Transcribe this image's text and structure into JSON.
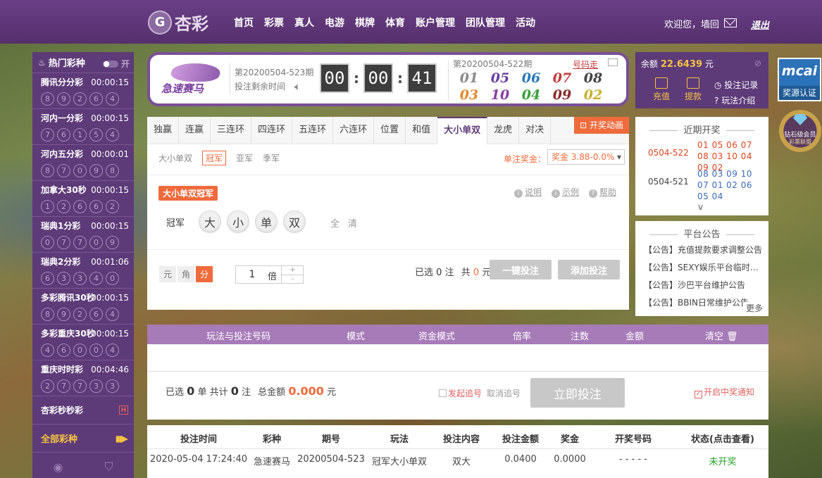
{
  "nav": {
    "logo_char": "G",
    "logo_text": "杏彩",
    "items": [
      "首页",
      "彩票",
      "真人",
      "电游",
      "棋牌",
      "体育",
      "账户管理",
      "团队管理",
      "活动"
    ],
    "welcome": "欢迎您，墙回",
    "logout": "退出"
  },
  "sidebar": {
    "title": "热门彩种",
    "toggle": "开",
    "games": [
      {
        "name": "腾讯分分彩",
        "time": "00:00:15",
        "balls": [
          "8",
          "9",
          "2",
          "6",
          "4"
        ]
      },
      {
        "name": "河内一分彩",
        "time": "00:00:15",
        "balls": [
          "7",
          "6",
          "1",
          "5",
          "4"
        ]
      },
      {
        "name": "河内五分彩",
        "time": "00:00:01",
        "balls": [
          "8",
          "7",
          "0",
          "9",
          "8"
        ]
      },
      {
        "name": "加拿大30秒",
        "time": "00:00:15",
        "balls": [
          "1",
          "2",
          "6",
          "6",
          "2"
        ]
      },
      {
        "name": "瑞典1分彩",
        "time": "00:00:15",
        "balls": [
          "0",
          "7",
          "7",
          "0",
          "9"
        ]
      },
      {
        "name": "瑞典2分彩",
        "time": "00:01:06",
        "balls": [
          "6",
          "3",
          "3",
          "4",
          "0"
        ]
      },
      {
        "name": "多彩腾讯30秒",
        "time": "00:00:15",
        "balls": [
          "8",
          "9",
          "2",
          "6",
          "4"
        ]
      },
      {
        "name": "多彩重庆30秒",
        "time": "00:00:15",
        "balls": [
          "4",
          "6",
          "0",
          "0",
          "4"
        ]
      },
      {
        "name": "重庆时时彩",
        "time": "00:04:46",
        "balls": [
          "2",
          "7",
          "7",
          "3",
          "3"
        ]
      }
    ],
    "special": "杏彩秒秒彩",
    "all": "全部彩种"
  },
  "lottery": {
    "logo_text": "急速赛马",
    "period": "第20200504-523期",
    "remain_label": "投注剩余时间",
    "timer": [
      "00",
      "00",
      "41"
    ],
    "last_period": "第20200504-522期",
    "trend": "号码走",
    "results": [
      {
        "num": "01",
        "color": "#8a8a8a"
      },
      {
        "num": "05",
        "color": "#6a3fa0"
      },
      {
        "num": "06",
        "color": "#2a7ab8"
      },
      {
        "num": "07",
        "color": "#c43a3a"
      },
      {
        "num": "08",
        "color": "#444444"
      },
      {
        "num": "03",
        "color": "#e08a2a"
      },
      {
        "num": "10",
        "color": "#8a3fa0"
      },
      {
        "num": "04",
        "color": "#3aa03a"
      },
      {
        "num": "09",
        "color": "#8a2a2a"
      },
      {
        "num": "02",
        "color": "#c8b030"
      }
    ]
  },
  "balance": {
    "label": "余额",
    "amount": "22.6439",
    "unit": "元",
    "recharge": "充值",
    "withdraw": "提款",
    "record": "投注记录",
    "rules": "玩法介绍"
  },
  "recent": {
    "title": "近期开奖",
    "rows": [
      {
        "id": "0504-522",
        "nums": "01 05 06 07 08 03 10 04 09 02",
        "color": "#d9441c"
      },
      {
        "id": "0504-521",
        "nums": "08 03 09 10 07 01 02 06 05 04",
        "color": "#3a6ab8"
      }
    ],
    "more_icon": "v"
  },
  "notice": {
    "title": "平台公告",
    "items": [
      "【公告】充值提款要求调整公告",
      "【公告】SEXY娱乐平台临时维...",
      "【公告】沙巴平台维护公告",
      "【公告】BBIN日常维护公告"
    ],
    "more": "更多"
  },
  "badges": {
    "mcai": "mcai",
    "mcai_sub": "奖源认证",
    "diamond_1": "钻石级会员",
    "diamond_2": "彩票联盟"
  },
  "play": {
    "tabs": [
      "独赢",
      "连赢",
      "三连环",
      "四连环",
      "五连环",
      "六连环",
      "位置",
      "和值",
      "大小单双",
      "龙虎",
      "对决"
    ],
    "active_tab": 8,
    "open_anim": "开奖动画",
    "subtabs": [
      "大小单双",
      "冠军",
      "亚军",
      "季军"
    ],
    "active_subtab": 1,
    "bonus_label": "单注奖金：",
    "bonus_value": "奖金 3.88-0.0%",
    "mode_title": "大小单双冠军",
    "help": [
      "说明",
      "示例",
      "帮助"
    ],
    "position": "冠军",
    "picks": [
      "大",
      "小",
      "单",
      "双"
    ],
    "quick": [
      "全",
      "清"
    ],
    "units": [
      "元",
      "角",
      "分"
    ],
    "active_unit": 2,
    "multiple": "1",
    "multiple_label": "倍",
    "selected_text": "已选",
    "selected_count": "0",
    "zhu": "注",
    "total_text": "共",
    "total_amount": "0",
    "yuan": "元",
    "one_click": "一键投注",
    "add_bet": "添加投注"
  },
  "order": {
    "headers": [
      "玩法与投注号码",
      "模式",
      "资金模式",
      "倍率",
      "注数",
      "金额",
      "清空"
    ],
    "selected": "已选",
    "sel_count": "0",
    "unit": "单 共计",
    "bet_count": "0",
    "zhu": "注",
    "total_label": "总金额",
    "total": "0.000",
    "yuan": "元",
    "chase": "发起追号",
    "cancel_chase": "取消追号",
    "submit": "立即投注",
    "notify": "开启中奖通知"
  },
  "history": {
    "headers": [
      "投注时间",
      "彩种",
      "期号",
      "玩法",
      "投注内容",
      "投注金额",
      "奖金",
      "开奖号码",
      "状态(点击查看)"
    ],
    "rows": [
      [
        "2020-05-04 17:24:40",
        "急速赛马",
        "20200504-523",
        "冠军大小单双",
        "双大",
        "0.0400",
        "0.0000",
        "- - - - -",
        "未开奖"
      ]
    ]
  }
}
